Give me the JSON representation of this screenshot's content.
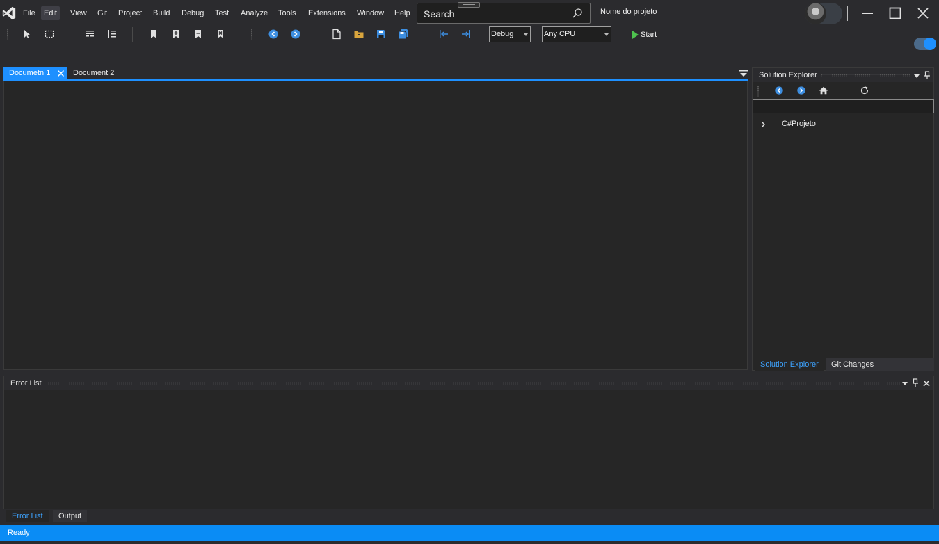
{
  "menubar": {
    "items": [
      "File",
      "Edit",
      "View",
      "Git",
      "Project",
      "Build",
      "Debug",
      "Test",
      "Analyze",
      "Tools",
      "Extensions",
      "Window",
      "Help"
    ],
    "active_item": "Edit"
  },
  "search": {
    "placeholder": "Search"
  },
  "project_name": "Nome do projeto",
  "toolbar": {
    "configuration": "Debug",
    "platform": "Any CPU",
    "start_label": "Start"
  },
  "document_tabs": [
    {
      "label": "Documetn 1",
      "active": true
    },
    {
      "label": "Document 2",
      "active": false
    }
  ],
  "solution_explorer": {
    "title": "Solution Explorer",
    "tree": [
      {
        "label": "C#Projeto",
        "expanded": false
      }
    ],
    "tabs": [
      {
        "label": "Solution Explorer",
        "active": true
      },
      {
        "label": "Git Changes",
        "active": false
      }
    ]
  },
  "error_list": {
    "title": "Error List",
    "tabs": [
      {
        "label": "Error List",
        "active": true
      },
      {
        "label": "Output",
        "active": false
      }
    ]
  },
  "status_bar": {
    "text": "Ready"
  },
  "theme": {
    "accent": "#1e90ff",
    "status_bar": "#0a8cf5",
    "start_green": "#4ec24e",
    "background": "#2b2b2e",
    "panel": "#262626"
  },
  "icons": [
    "visual-studio-logo-icon",
    "search-icon",
    "minimize-icon",
    "maximize-icon",
    "close-icon",
    "pointer-icon",
    "select-rect-icon",
    "comment-lines-icon",
    "numbered-lines-icon",
    "bookmark-icon",
    "add-bookmark-icon",
    "prev-bookmark-icon",
    "clear-bookmark-icon",
    "nav-back-icon",
    "nav-forward-icon",
    "new-file-icon",
    "open-folder-icon",
    "save-icon",
    "save-all-icon",
    "outdent-icon",
    "indent-icon",
    "play-icon",
    "home-icon",
    "refresh-icon",
    "pin-icon",
    "dropdown-icon",
    "chevron-right-icon"
  ]
}
